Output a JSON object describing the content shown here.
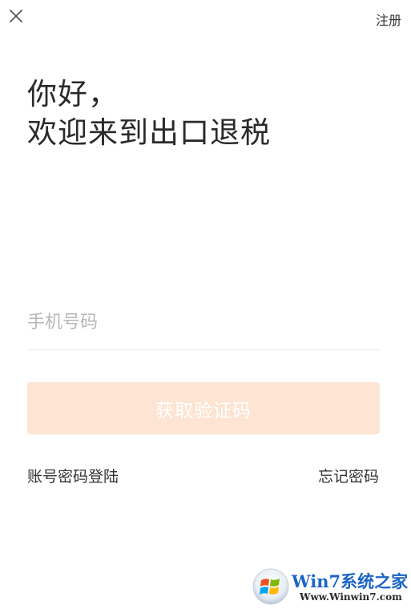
{
  "header": {
    "close_icon": "close-icon",
    "register_label": "注册"
  },
  "greeting": {
    "line1": "你好，",
    "line2": "欢迎来到出口退税"
  },
  "phone": {
    "placeholder": "手机号码",
    "value": ""
  },
  "get_code": {
    "label": "获取验证码",
    "color": "#fde4d3"
  },
  "links": {
    "account_login": "账号密码登陆",
    "forgot_password": "忘记密码"
  },
  "watermark": {
    "logo_icon": "windows-logo-icon",
    "title": "Win7系统之家",
    "url": "Www.Winwin7.com"
  }
}
